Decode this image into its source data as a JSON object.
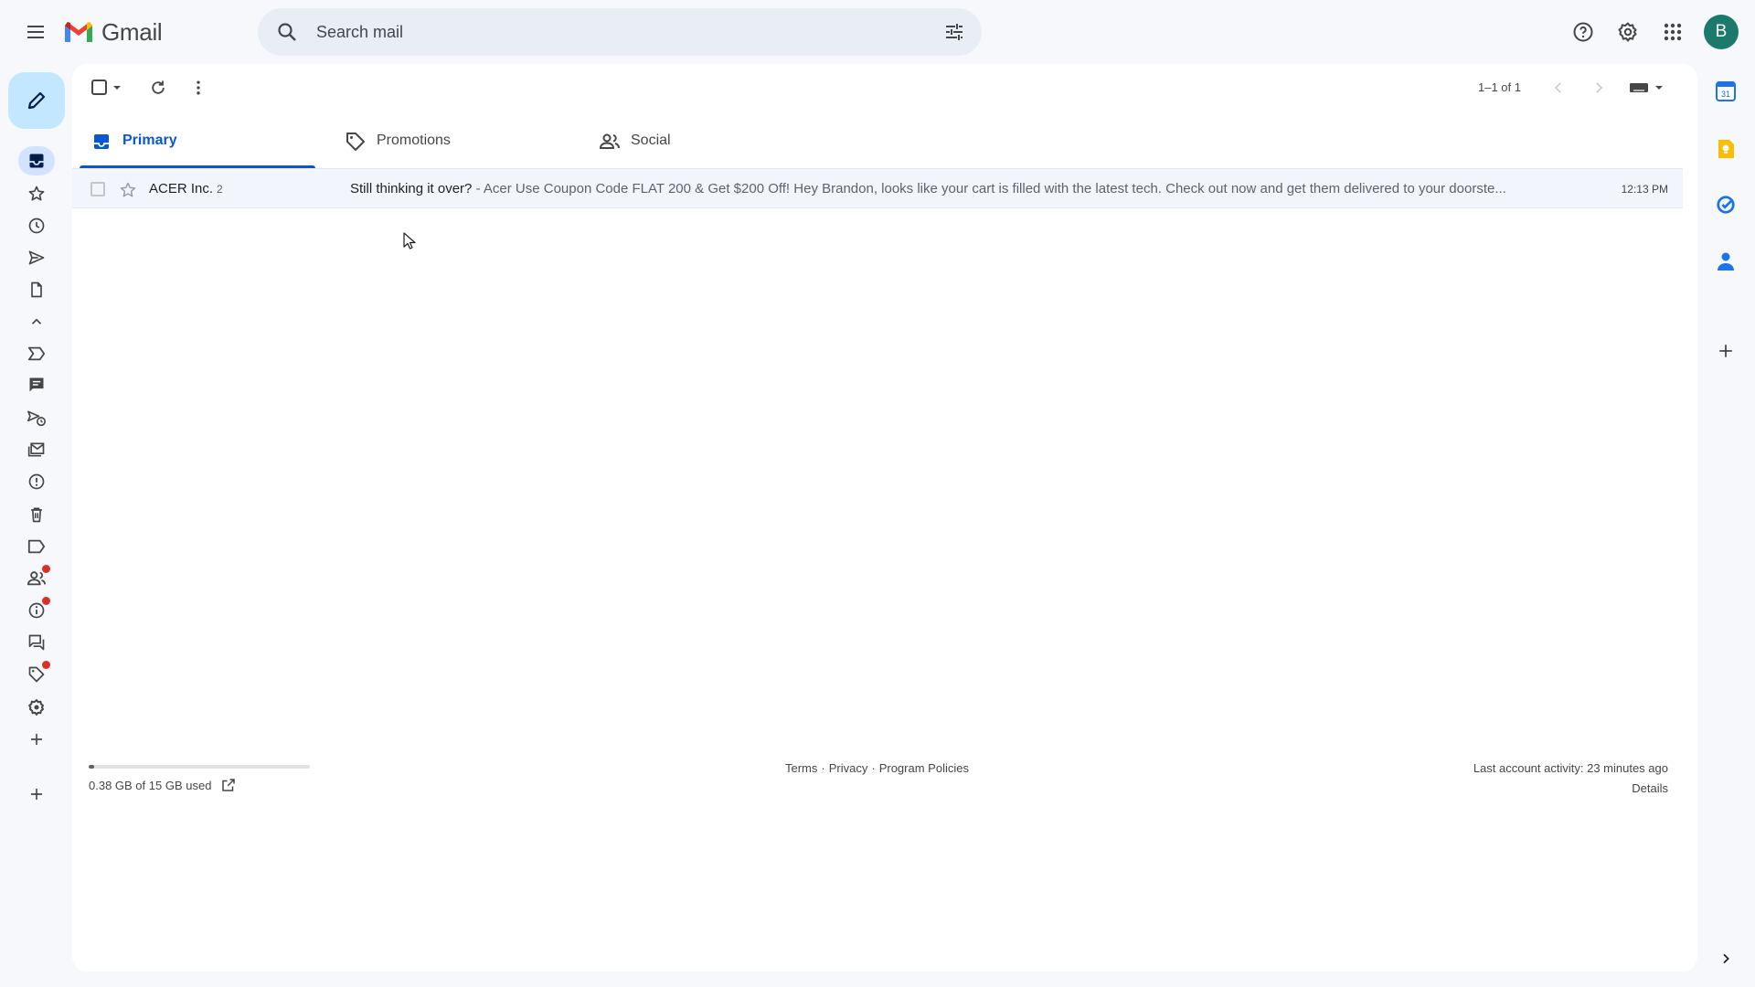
{
  "app": {
    "name": "Gmail"
  },
  "search": {
    "placeholder": "Search mail"
  },
  "header": {
    "help_icon": "help-circle",
    "settings_icon": "gear",
    "apps_icon": "grid",
    "avatar_initial": "B",
    "avatar_color": "#1b7a6b"
  },
  "nav": {
    "compose_icon": "pencil",
    "items": [
      {
        "name": "inbox",
        "icon": "inbox",
        "active": true
      },
      {
        "name": "starred",
        "icon": "star"
      },
      {
        "name": "snoozed",
        "icon": "clock"
      },
      {
        "name": "sent",
        "icon": "send"
      },
      {
        "name": "drafts",
        "icon": "file"
      },
      {
        "name": "less",
        "icon": "chevron-up"
      },
      {
        "name": "important",
        "icon": "label-important"
      },
      {
        "name": "chats",
        "icon": "chat"
      },
      {
        "name": "scheduled",
        "icon": "scheduled-send"
      },
      {
        "name": "all-mail",
        "icon": "mail-stack"
      },
      {
        "name": "spam",
        "icon": "alert-circle"
      },
      {
        "name": "trash",
        "icon": "trash"
      },
      {
        "name": "categories",
        "icon": "label"
      },
      {
        "name": "social",
        "icon": "people",
        "badge": true
      },
      {
        "name": "updates",
        "icon": "info",
        "badge": true
      },
      {
        "name": "forums",
        "icon": "forum"
      },
      {
        "name": "promotions",
        "icon": "tag",
        "badge": true
      },
      {
        "name": "manage-labels",
        "icon": "gear"
      },
      {
        "name": "create-label",
        "icon": "plus"
      }
    ],
    "add_icon": "plus"
  },
  "toolbar": {
    "page_count": "1–1 of 1"
  },
  "tabs": [
    {
      "label": "Primary",
      "icon": "inbox",
      "active": true
    },
    {
      "label": "Promotions",
      "icon": "tag"
    },
    {
      "label": "Social",
      "icon": "people"
    }
  ],
  "emails": [
    {
      "sender": "ACER Inc.",
      "count": "2",
      "subject": "Still thinking it over?",
      "snippet": " - Acer Use Coupon Code FLAT 200 & Get $200 Off! Hey Brandon, looks like your cart is filled with the latest tech. Check out now and get them delivered to your doorste...",
      "time": "12:13 PM"
    }
  ],
  "footer": {
    "storage_text": "0.38 GB of 15 GB used",
    "storage_fraction": 0.025,
    "links": [
      "Terms",
      "Privacy",
      "Program Policies"
    ],
    "activity": "Last account activity: 23 minutes ago",
    "details": "Details"
  },
  "side_panel": {
    "icons": [
      "calendar",
      "keep",
      "tasks",
      "contacts",
      "plus"
    ],
    "calendar_date": "31"
  },
  "colors": {
    "accent": "#0b57d0",
    "compose_bg": "#c2e7ff",
    "active_nav": "#d3e3fd",
    "badge": "#d93025"
  }
}
